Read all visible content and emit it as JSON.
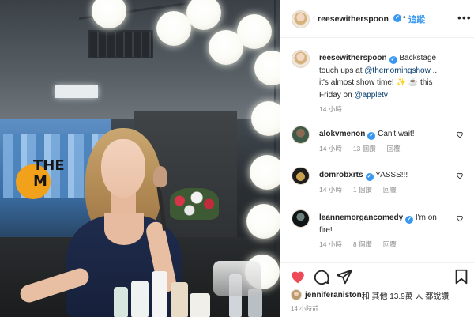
{
  "post": {
    "author": "reesewitherspoon",
    "follow_label": "追蹤",
    "caption": {
      "username": "reesewitherspoon",
      "text_1": " Backstage touch ups at ",
      "mention_1": "@themorningshow",
      "text_2": " ... it's almost show time! ✨ ☕ this Friday on ",
      "mention_2": "@appletv",
      "time": "14 小時"
    },
    "comments": [
      {
        "username": "alokvmenon",
        "text": " Can't wait!",
        "time": "14 小時",
        "likes": "13 個讚",
        "reply": "回覆"
      },
      {
        "username": "domrobxrts",
        "text": " YASSS!!!",
        "time": "14 小時",
        "likes": "1 個讚",
        "reply": "回覆"
      },
      {
        "username": "leannemorgancomedy",
        "text": " I'm on fire!",
        "time": "14 小時",
        "likes": "8 個讚",
        "reply": "回覆"
      }
    ],
    "liked_by": {
      "username": "jenniferaniston",
      "suffix": " 和 其他 13.9萬 人 都說讚"
    },
    "post_time": "14 小時前",
    "photo_sign": {
      "line1": "THE",
      "line2": "M"
    }
  },
  "colors": {
    "link": "#3897f0",
    "mention": "#00376b",
    "like_red": "#ed4956",
    "muted": "#8e8e8e"
  },
  "icons": [
    "verified-badge-icon",
    "more-options-icon",
    "heart-icon",
    "comment-icon",
    "share-icon",
    "bookmark-icon"
  ]
}
